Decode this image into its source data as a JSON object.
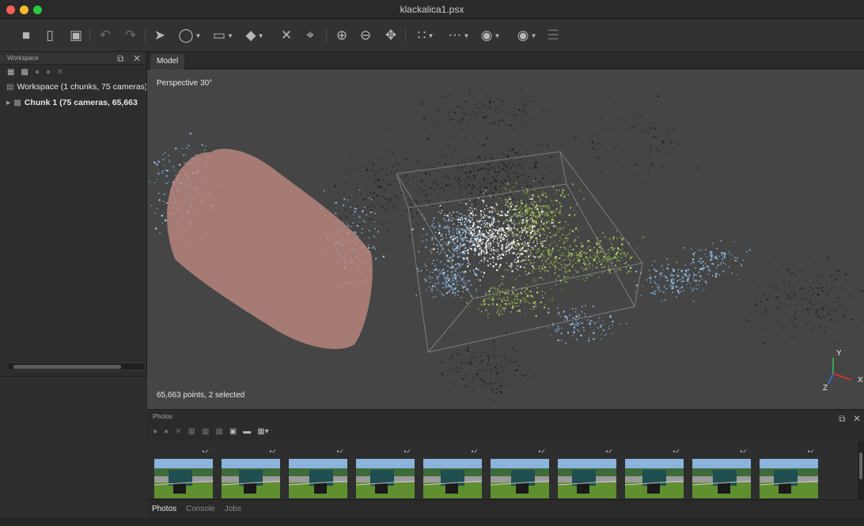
{
  "window": {
    "title": "klackalica1.psx"
  },
  "toolbar": {
    "icons": [
      "new-file-icon",
      "open-folder-icon",
      "save-icon",
      "undo-icon",
      "redo-icon",
      "select-pointer-icon",
      "lasso-select-icon",
      "draw-shape-icon",
      "resize-region-icon",
      "delete-icon",
      "crop-icon",
      "zoom-in-icon",
      "zoom-out-icon",
      "navigate-icon",
      "point-cloud-icon",
      "dense-cloud-icon",
      "mesh-shading-icon",
      "camera-icon",
      "layers-icon"
    ]
  },
  "workspace": {
    "title": "Workspace",
    "root_label": "Workspace (1 chunks, 75 cameras)",
    "chunk_label": "Chunk 1 (75 cameras, 65,663"
  },
  "model": {
    "tab_label": "Model",
    "perspective_label": "Perspective 30°",
    "points_status": "65,663 points, 2 selected",
    "axes": {
      "x": "X",
      "y": "Y",
      "z": "Z"
    },
    "colors": {
      "selection": "#c08b82",
      "background": "#454545"
    }
  },
  "photos": {
    "title": "Photos",
    "thumbnail_count": 10,
    "thumb_flags": "▪✓"
  },
  "bottom_tabs": [
    "Photos",
    "Console",
    "Jobs"
  ]
}
